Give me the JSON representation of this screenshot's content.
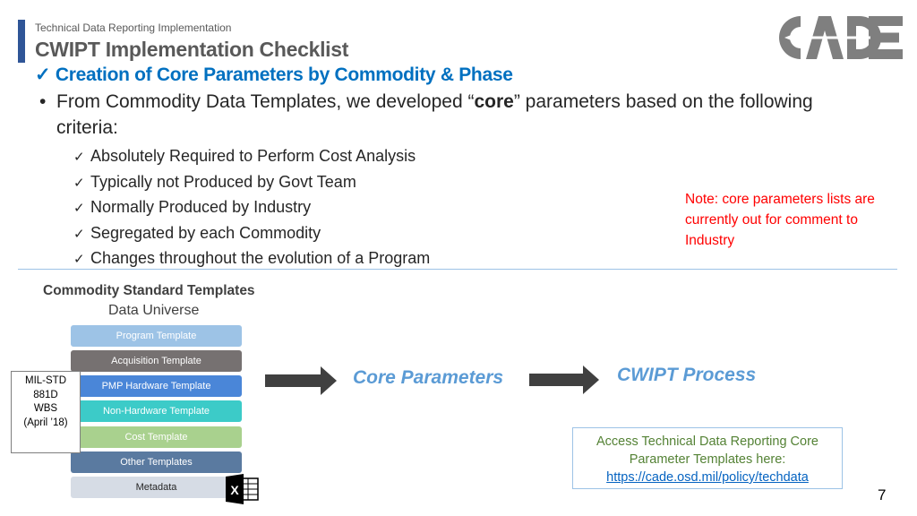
{
  "header": {
    "subtitle": "Technical Data Reporting Implementation",
    "title": "CWIPT Implementation Checklist",
    "heading_check": "✓",
    "heading": "Creation of Core Parameters by Commodity & Phase",
    "logo_text": "CADE"
  },
  "body": {
    "bullet_marker": "•",
    "bullet_pre": "From Commodity Data Templates, we developed “",
    "bullet_bold": "core",
    "bullet_post": "” parameters based on the following criteria:",
    "check_glyph": "✓",
    "criteria": [
      "Absolutely Required to Perform Cost Analysis",
      "Typically not Produced by Govt Team",
      "Normally Produced by Industry",
      "Segregated by each Commodity",
      "Changes throughout the evolution of a Program"
    ],
    "note": "Note:  core parameters lists are currently out for comment to Industry"
  },
  "diagram": {
    "title": "Commodity Standard Templates",
    "subtitle": "Data Universe",
    "templates": [
      {
        "label": "Program Template",
        "color": "#9dc3e6",
        "text_color": "#ffffff"
      },
      {
        "label": "Acquisition Template",
        "color": "#767171",
        "text_color": "#ffffff"
      },
      {
        "label": "PMP Hardware Template",
        "color": "#4a86d8",
        "text_color": "#ffffff"
      },
      {
        "label": "Non-Hardware Template",
        "color": "#3ccbc8",
        "text_color": "#ffffff"
      },
      {
        "label": "Cost Template",
        "color": "#a9d18e",
        "text_color": "#ffffff"
      },
      {
        "label": "Other Templates",
        "color": "#5a7aa0",
        "text_color": "#ffffff"
      },
      {
        "label": "Metadata",
        "color": "#d6dce5",
        "text_color": "#262626"
      }
    ],
    "milstd_lines": [
      "MIL-STD",
      "881D",
      "WBS",
      "(April ’18)"
    ],
    "excel_icon": "excel-icon",
    "core_parameters": "Core Parameters",
    "cwipt_process": "CWIPT Process"
  },
  "access_box": {
    "line1": "Access Technical Data Reporting Core",
    "line2": "Parameter Templates here:",
    "link": "https://cade.osd.mil/policy/techdata"
  },
  "page_number": "7"
}
